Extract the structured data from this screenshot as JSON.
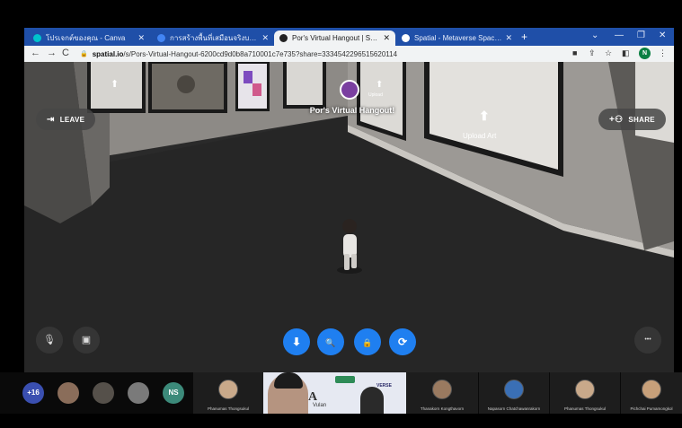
{
  "browser": {
    "tabs": [
      {
        "title": "โปรเจกต์ของคุณ - Canva",
        "favicon_color": "#00c4cc",
        "active": false
      },
      {
        "title": "การสร้างพื้นที่เสมือนจริงบนเว็บ",
        "favicon_color": "#4285f4",
        "active": false
      },
      {
        "title": "Por's Virtual Hangout | Spatial",
        "favicon_color": "#222222",
        "active": true
      },
      {
        "title": "Spatial - Metaverse Spaces That ...",
        "favicon_color": "#222222",
        "active": false
      }
    ],
    "url_host": "spatial.io",
    "url_path": "/s/Pors-Virtual-Hangout-6200cd9d0b8a710001c7e735?share=3334542296515620114",
    "profile_initial": "N"
  },
  "spatial": {
    "leave_label": "LEAVE",
    "share_label": "SHARE",
    "room_title": "Por's Virtual Hangout!",
    "upload_art_label": "Upload Art",
    "upload_small_label": "Upload",
    "accent_color": "#1f7ff0",
    "bottom_buttons": [
      {
        "icon": "download-icon",
        "glyph": "⬇"
      },
      {
        "icon": "zoom-icon",
        "glyph": "🔍"
      },
      {
        "icon": "lock-icon",
        "glyph": "🔒"
      },
      {
        "icon": "refresh-icon",
        "glyph": "⟳"
      }
    ],
    "mute_glyph": "🎙",
    "camera_glyph": "▣",
    "more_glyph": "•••"
  },
  "meeting": {
    "extra_count": "+16",
    "initials_participant": "NS",
    "participants": [
      {
        "name": "Phanumas Thongsukul"
      },
      {
        "name": "Thanakorn Kongthavorn"
      },
      {
        "name": "Napasorn Chatchawanrakorn"
      },
      {
        "name": "Phanumas Thongsukul"
      },
      {
        "name": "Pichchai Pumamongkol"
      }
    ],
    "video_text_main": "A",
    "video_text_sub": "Vulan",
    "video_text_side": "VERSE"
  }
}
